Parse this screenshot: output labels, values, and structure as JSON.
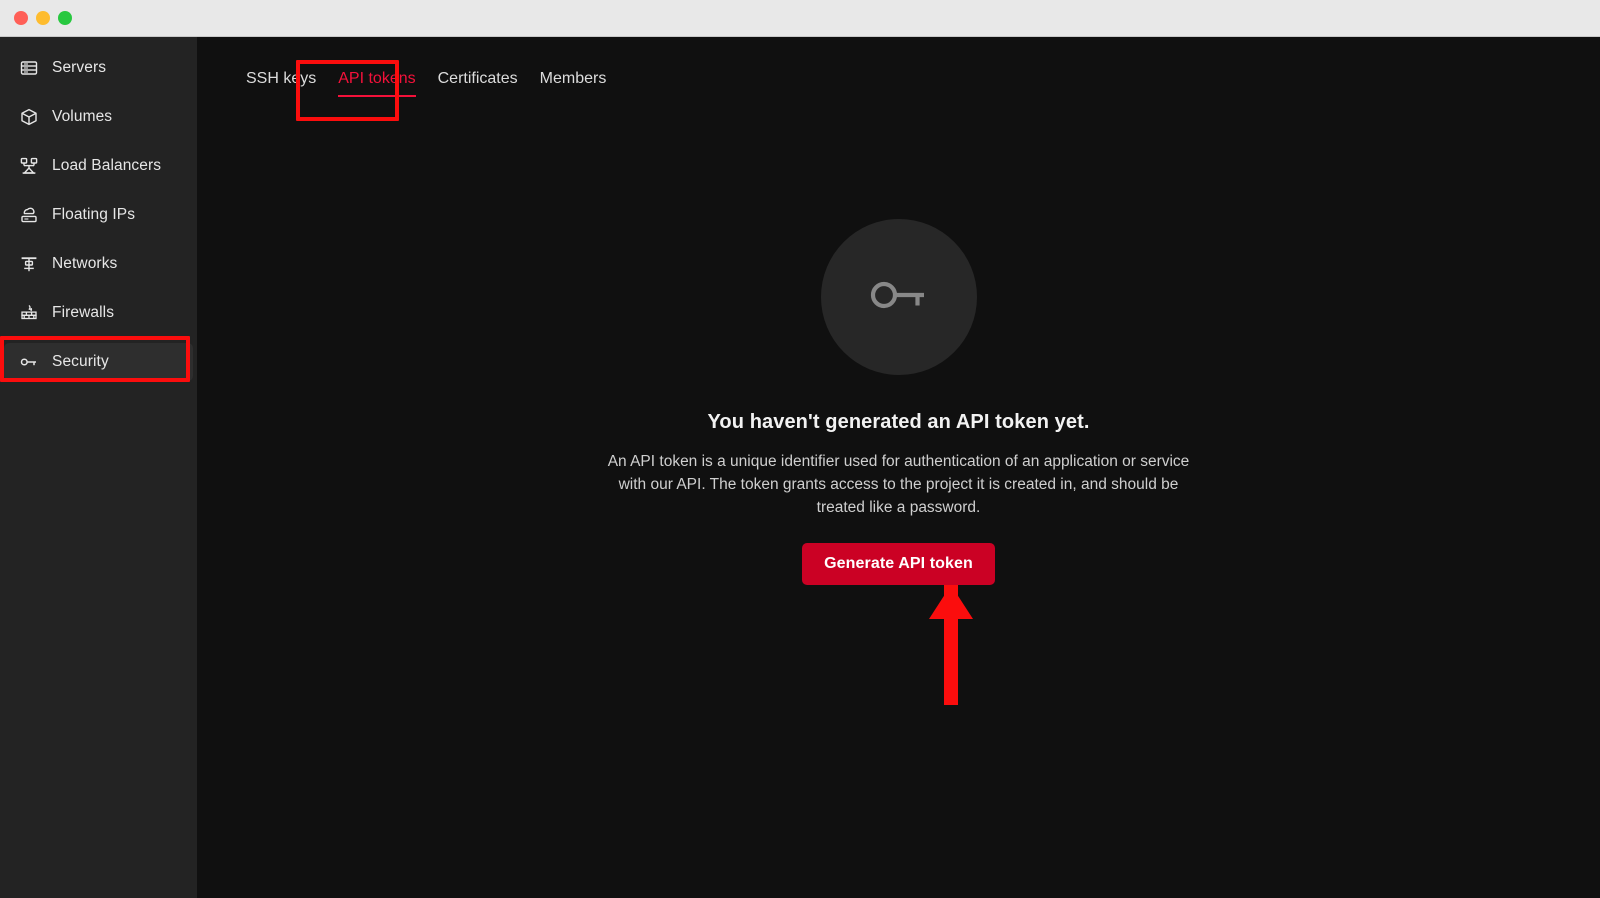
{
  "window": {
    "traffic_lights": [
      "close",
      "minimize",
      "maximize"
    ],
    "colors": {
      "close": "#ff5f57",
      "minimize": "#febc2e",
      "maximize": "#28c840",
      "titlebar_bg": "#e8e8e8",
      "sidebar_bg": "#232323",
      "content_bg": "#101010",
      "accent_red": "#cb0124",
      "annotation_red": "#fb0d0d",
      "tab_active": "#f4113a"
    }
  },
  "sidebar": {
    "items": [
      {
        "label": "Servers",
        "icon": "servers-icon",
        "active": false
      },
      {
        "label": "Volumes",
        "icon": "volumes-icon",
        "active": false
      },
      {
        "label": "Load Balancers",
        "icon": "load-balancers-icon",
        "active": false
      },
      {
        "label": "Floating IPs",
        "icon": "floating-ips-icon",
        "active": false
      },
      {
        "label": "Networks",
        "icon": "networks-icon",
        "active": false
      },
      {
        "label": "Firewalls",
        "icon": "firewalls-icon",
        "active": false
      },
      {
        "label": "Security",
        "icon": "security-key-icon",
        "active": true
      }
    ]
  },
  "main": {
    "tabs": [
      {
        "label": "SSH keys",
        "active": false
      },
      {
        "label": "API tokens",
        "active": true
      },
      {
        "label": "Certificates",
        "active": false
      },
      {
        "label": "Members",
        "active": false
      }
    ],
    "empty_state": {
      "icon": "key-icon",
      "title": "You haven't generated an API token yet.",
      "description": "An API token is a unique identifier used for authentication of an application or service with our API. The token grants access to the project it is created in, and should be treated like a password.",
      "button_label": "Generate API token"
    }
  },
  "annotations": [
    {
      "name": "security-sidebar-highlight",
      "shape": "rectangle",
      "color": "#fb0d0d"
    },
    {
      "name": "api-tokens-tab-highlight",
      "shape": "rectangle",
      "color": "#fb0d0d"
    },
    {
      "name": "generate-button-pointer",
      "shape": "arrow-up",
      "color": "#fb0d0d"
    }
  ]
}
